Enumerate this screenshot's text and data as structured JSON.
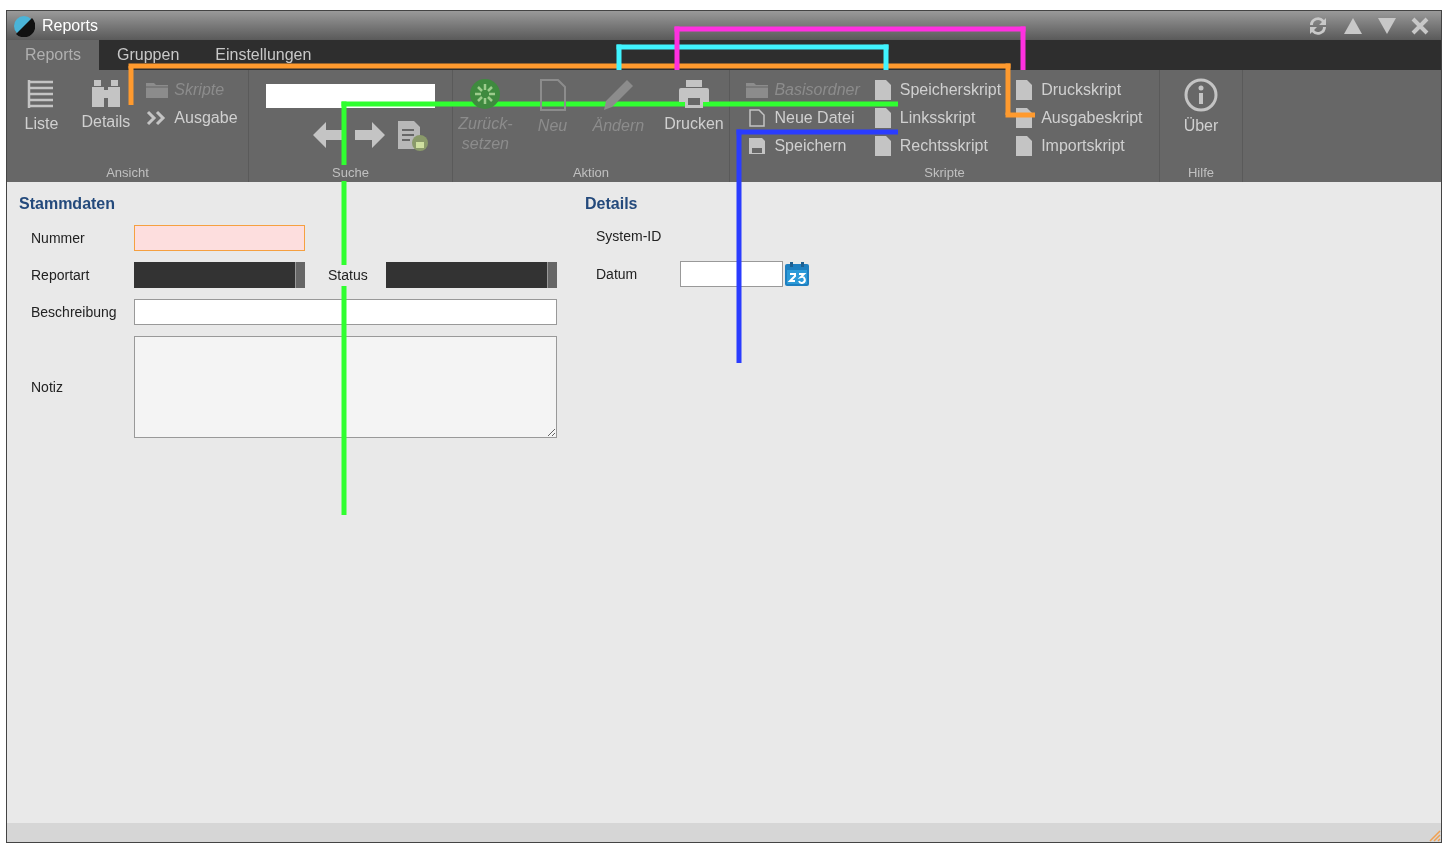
{
  "window": {
    "title": "Reports"
  },
  "tabs": [
    {
      "label": "Reports",
      "selected": true
    },
    {
      "label": "Gruppen",
      "selected": false
    },
    {
      "label": "Einstellungen",
      "selected": false
    }
  ],
  "ribbon": {
    "groups": [
      {
        "label": "Ansicht",
        "items": [
          {
            "kind": "big",
            "label": "Liste",
            "disabled": false
          },
          {
            "kind": "big",
            "label": "Details",
            "disabled": false
          },
          {
            "kind": "stack",
            "items": [
              {
                "label": "Skripte",
                "disabled": true
              },
              {
                "label": "Ausgabe",
                "disabled": false
              }
            ]
          }
        ]
      },
      {
        "label": "Suche",
        "items": [
          {
            "kind": "search"
          }
        ]
      },
      {
        "label": "Aktion",
        "items": [
          {
            "kind": "big",
            "label": "Zurück-\nsetzen",
            "disabled": true
          },
          {
            "kind": "big",
            "label": "Neu",
            "disabled": true
          },
          {
            "kind": "big",
            "label": "Ändern",
            "disabled": true
          },
          {
            "kind": "big",
            "label": "Drucken",
            "disabled": false
          }
        ]
      },
      {
        "label": "Skripte",
        "items": [
          {
            "kind": "stack",
            "items": [
              {
                "label": "Basisordner",
                "disabled": true
              },
              {
                "label": "Neue Datei",
                "disabled": false
              },
              {
                "label": "Speichern",
                "disabled": false
              }
            ]
          },
          {
            "kind": "stack",
            "items": [
              {
                "label": "Speicherskript",
                "disabled": false
              },
              {
                "label": "Linksskript",
                "disabled": false
              },
              {
                "label": "Rechtsskript",
                "disabled": false
              }
            ]
          },
          {
            "kind": "stack",
            "items": [
              {
                "label": "Druckskript",
                "disabled": false
              },
              {
                "label": "Ausgabeskript",
                "disabled": false
              },
              {
                "label": "Importskript",
                "disabled": false
              }
            ]
          }
        ]
      },
      {
        "label": "Hilfe",
        "items": [
          {
            "kind": "big",
            "label": "Über",
            "disabled": false
          }
        ]
      }
    ]
  },
  "stammdaten": {
    "title": "Stammdaten",
    "nummer": {
      "label": "Nummer",
      "required": true
    },
    "reportart": {
      "label": "Reportart"
    },
    "status": {
      "label": "Status"
    },
    "beschreibung": {
      "label": "Beschreibung"
    },
    "notiz": {
      "label": "Notiz"
    }
  },
  "details": {
    "title": "Details",
    "system_id": {
      "label": "System-ID"
    },
    "datum": {
      "label": "Datum"
    }
  }
}
